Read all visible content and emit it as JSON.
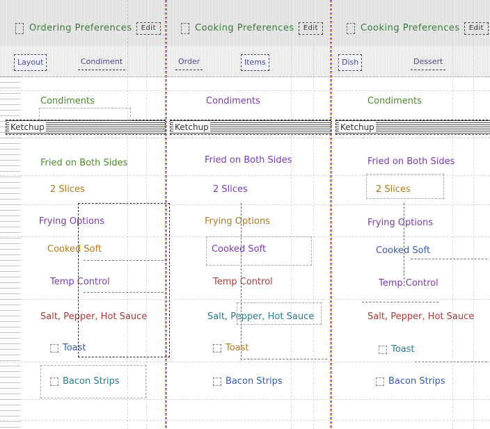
{
  "panels": [
    {
      "title": "Ordering Preferences",
      "badge": "Edit",
      "tabs": [
        "Layout",
        "Condiment",
        "Order",
        "Items",
        "Dish",
        "Dessert"
      ],
      "section_title": "Condiments",
      "field_value": "Ketchup",
      "type_label": "Fried on Both Sides",
      "count_label": "2 Slices",
      "fry_label": "Frying Options",
      "doneness": "Cooked Soft",
      "temp_label": "Temp Control",
      "salt_label": "Salt, Pepper, Hot Sauce",
      "toast_label": "Toast",
      "bacon_label": "Bacon Strips"
    },
    {
      "title": "Cooking Preferences",
      "badge": "Edit",
      "tabs": [
        "Layout",
        "Condiment",
        "Order",
        "Items",
        "Dish",
        "Dessert"
      ],
      "section_title": "Condiments",
      "field_value": "Ketchup",
      "type_label": "Fried on Both Sides",
      "count_label": "2 Slices",
      "fry_label": "Frying Options",
      "doneness": "Cooked Soft",
      "temp_label": "Temp Control",
      "salt_label": "Salt, Pepper, Hot Sauce",
      "toast_label": "Toast",
      "bacon_label": "Bacon Strips"
    },
    {
      "title": "Cooking Preferences",
      "badge": "Edit",
      "tabs": [
        "Layout",
        "Condiment",
        "Order",
        "Items",
        "Dish",
        "Dessert"
      ],
      "section_title": "Condiments",
      "field_value": "Ketchup",
      "type_label": "Fried on Both Sides",
      "count_label": "2 Slices",
      "fry_label": "Frying Options",
      "doneness": "Cooked Soft",
      "temp_label": "Temp Control",
      "salt_label": "Salt, Pepper, Hot Sauce",
      "toast_label": "Toast",
      "bacon_label": "Bacon Strips"
    }
  ],
  "colors": {
    "title": "#3a7a3a",
    "tab": "#4a4a8a",
    "accent_divider": "#6a3cc8",
    "accent_divider_alt": "#d08a2a"
  },
  "icons": {
    "panel_icon": "document-icon",
    "checkbox": "checkbox-icon"
  }
}
